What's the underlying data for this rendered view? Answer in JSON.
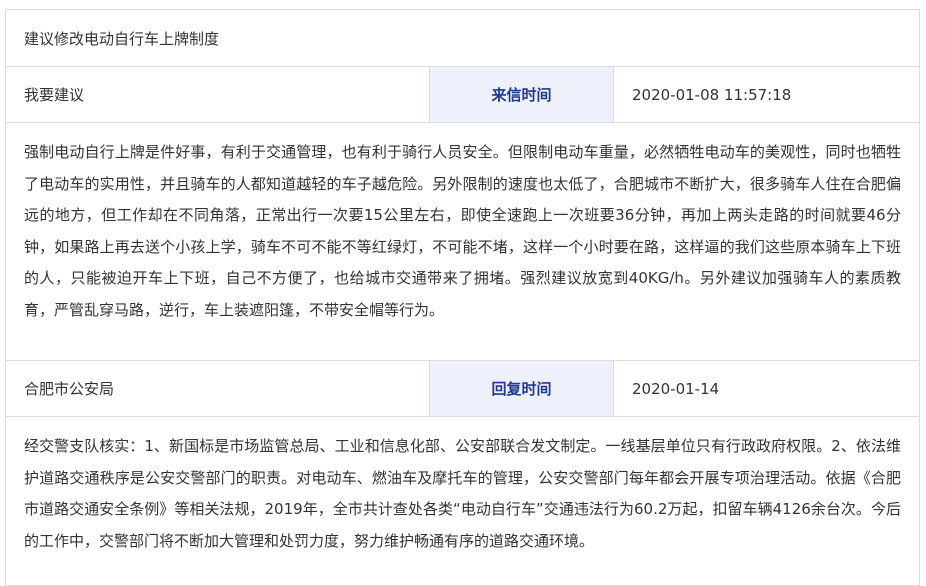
{
  "subject": "建议修改电动自行车上牌制度",
  "letter": {
    "type": "我要建议",
    "time_label": "来信时间",
    "time_value": "2020-01-08 11:57:18",
    "content": "强制电动自行上牌是件好事，有利于交通管理，也有利于骑行人员安全。但限制电动车重量，必然牺牲电动车的美观性，同时也牺牲了电动车的实用性，并且骑车的人都知道越轻的车子越危险。另外限制的速度也太低了，合肥城市不断扩大，很多骑车人住在合肥偏远的地方，但工作却在不同角落，正常出行一次要15公里左右，即使全速跑上一次班要36分钟，再加上两头走路的时间就要46分钟，如果路上再去送个小孩上学，骑车不可不能不等红绿灯，不可能不堵，这样一个小时要在路，这样逼的我们这些原本骑车上下班的人，只能被迫开车上下班，自己不方便了，也给城市交通带来了拥堵。强烈建议放宽到40KG/h。另外建议加强骑车人的素质教育，严管乱穿马路，逆行，车上装遮阳篷，不带安全帽等行为。"
  },
  "reply": {
    "department": "合肥市公安局",
    "time_label": "回复时间",
    "time_value": "2020-01-14",
    "content": "经交警支队核实：1、新国标是市场监管总局、工业和信息化部、公安部联合发文制定。一线基层单位只有行政政府权限。2、依法维护道路交通秩序是公安交警部门的职责。对电动车、燃油车及摩托车的管理，公安交警部门每年都会开展专项治理活动。依据《合肥市道路交通安全条例》等相关法规，2019年，全市共计查处各类“电动自行车”交通违法行为60.2万起，扣留车辆4126余台次。今后的工作中，交警部门将不断加大管理和处罚力度，努力维护畅通有序的道路交通环境。"
  },
  "colors": {
    "label_bg": "#eef0fb",
    "label_text": "#1f3a8f",
    "border": "#dcdcdc"
  }
}
